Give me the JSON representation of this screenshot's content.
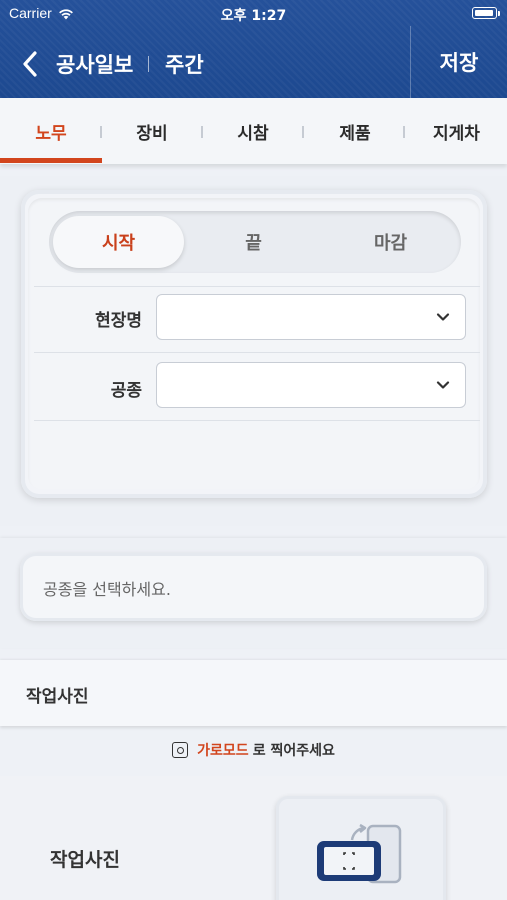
{
  "status_bar": {
    "carrier": "Carrier",
    "time": "오후 1:27"
  },
  "header": {
    "title": "공사일보",
    "subtitle": "주간",
    "save_label": "저장"
  },
  "tabs": [
    {
      "label": "노무",
      "active": true
    },
    {
      "label": "장비",
      "active": false
    },
    {
      "label": "시참",
      "active": false
    },
    {
      "label": "제품",
      "active": false
    },
    {
      "label": "지게차",
      "active": false
    }
  ],
  "segment": {
    "options": [
      "시작",
      "끝",
      "마감"
    ],
    "selected": "시작"
  },
  "form": {
    "site_label": "현장명",
    "site_value": "",
    "work_type_label": "공종",
    "work_type_value": ""
  },
  "message": {
    "text": "공종을 선택하세요."
  },
  "work_photo": {
    "section_title": "작업사진",
    "hint_prefix": "가로모드",
    "hint_suffix": "로 찍어주세요",
    "photo_label": "작업사진"
  },
  "colors": {
    "header_blue": "#1e4a91",
    "accent": "#d2451d"
  }
}
